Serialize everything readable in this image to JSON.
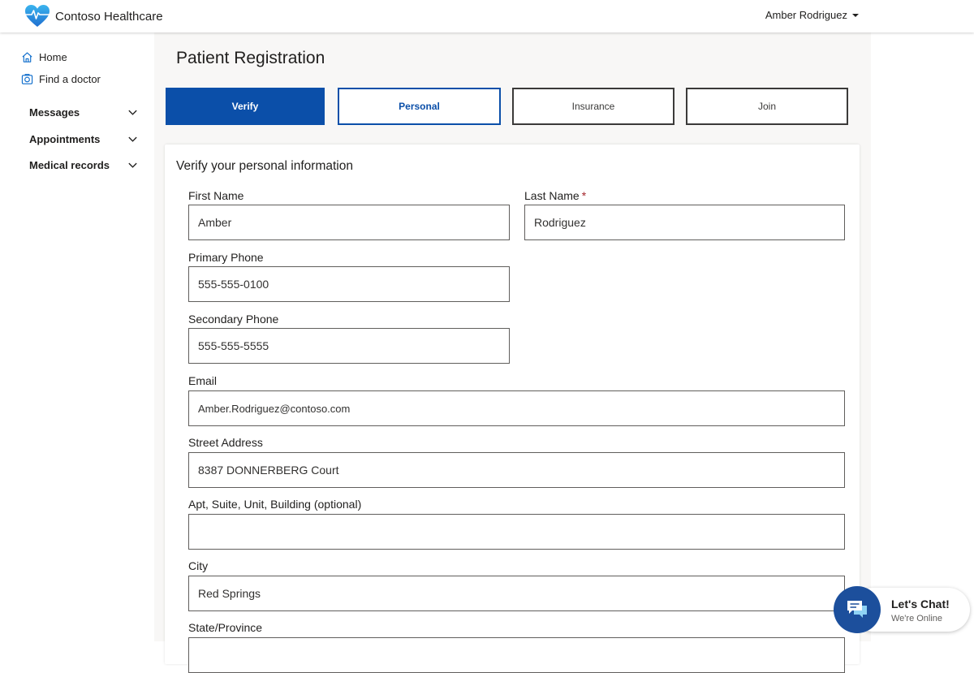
{
  "header": {
    "brand_name": "Contoso Healthcare",
    "user_name": "Amber Rodriguez",
    "brand_colors": {
      "heart_top": "#35a9e8",
      "heart_bottom": "#1f6fd0"
    }
  },
  "sidebar": {
    "links": [
      {
        "label": "Home",
        "icon": "home-icon"
      },
      {
        "label": "Find a doctor",
        "icon": "doctor-icon"
      }
    ],
    "groups": [
      {
        "label": "Messages",
        "icon": "chevron-down-icon"
      },
      {
        "label": "Appointments",
        "icon": "chevron-down-icon"
      },
      {
        "label": "Medical records",
        "icon": "chevron-down-icon"
      }
    ]
  },
  "main": {
    "title": "Patient Registration",
    "steps": [
      {
        "label": "Verify",
        "state": "active"
      },
      {
        "label": "Personal",
        "state": "current"
      },
      {
        "label": "Insurance",
        "state": "idle"
      },
      {
        "label": "Join",
        "state": "idle"
      }
    ],
    "accent_color": "#0b4fa9"
  },
  "form": {
    "title": "Verify your personal information",
    "required_marker": "*",
    "fields": {
      "first_name": {
        "label": "First Name",
        "value": "Amber"
      },
      "last_name": {
        "label": "Last Name",
        "value": "Rodriguez"
      },
      "primary_phone": {
        "label": "Primary Phone",
        "value": "555-555-0100"
      },
      "secondary_phone": {
        "label": "Secondary Phone",
        "value": "555-555-5555"
      },
      "email": {
        "label": "Email",
        "value": "Amber.Rodriguez@contoso.com"
      },
      "street": {
        "label": "Street Address",
        "value": "8387 DONNERBERG Court"
      },
      "apt": {
        "label": "Apt, Suite, Unit, Building (optional)",
        "value": ""
      },
      "city": {
        "label": "City",
        "value": "Red Springs"
      },
      "state": {
        "label": "State/Province",
        "value": ""
      }
    }
  },
  "chat": {
    "title": "Let's Chat!",
    "status": "We're Online",
    "icon": "chat-bubbles-icon"
  }
}
